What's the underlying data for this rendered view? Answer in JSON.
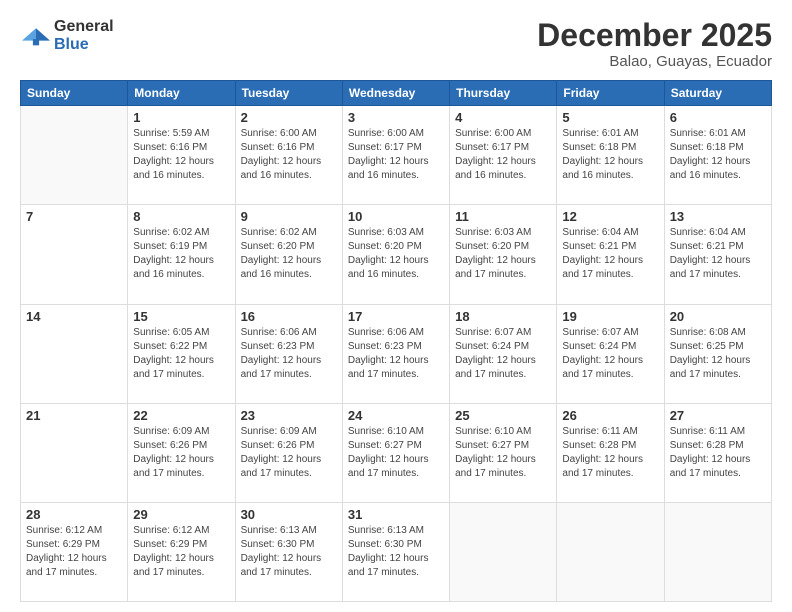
{
  "logo": {
    "general": "General",
    "blue": "Blue"
  },
  "header": {
    "month": "December 2025",
    "location": "Balao, Guayas, Ecuador"
  },
  "weekdays": [
    "Sunday",
    "Monday",
    "Tuesday",
    "Wednesday",
    "Thursday",
    "Friday",
    "Saturday"
  ],
  "weeks": [
    [
      {
        "day": "",
        "info": ""
      },
      {
        "day": "1",
        "info": "Sunrise: 5:59 AM\nSunset: 6:16 PM\nDaylight: 12 hours and 16 minutes."
      },
      {
        "day": "2",
        "info": "Sunrise: 6:00 AM\nSunset: 6:16 PM\nDaylight: 12 hours and 16 minutes."
      },
      {
        "day": "3",
        "info": "Sunrise: 6:00 AM\nSunset: 6:17 PM\nDaylight: 12 hours and 16 minutes."
      },
      {
        "day": "4",
        "info": "Sunrise: 6:00 AM\nSunset: 6:17 PM\nDaylight: 12 hours and 16 minutes."
      },
      {
        "day": "5",
        "info": "Sunrise: 6:01 AM\nSunset: 6:18 PM\nDaylight: 12 hours and 16 minutes."
      },
      {
        "day": "6",
        "info": "Sunrise: 6:01 AM\nSunset: 6:18 PM\nDaylight: 12 hours and 16 minutes."
      }
    ],
    [
      {
        "day": "7",
        "info": ""
      },
      {
        "day": "8",
        "info": "Sunrise: 6:02 AM\nSunset: 6:19 PM\nDaylight: 12 hours and 16 minutes."
      },
      {
        "day": "9",
        "info": "Sunrise: 6:02 AM\nSunset: 6:20 PM\nDaylight: 12 hours and 16 minutes."
      },
      {
        "day": "10",
        "info": "Sunrise: 6:03 AM\nSunset: 6:20 PM\nDaylight: 12 hours and 16 minutes."
      },
      {
        "day": "11",
        "info": "Sunrise: 6:03 AM\nSunset: 6:20 PM\nDaylight: 12 hours and 17 minutes."
      },
      {
        "day": "12",
        "info": "Sunrise: 6:04 AM\nSunset: 6:21 PM\nDaylight: 12 hours and 17 minutes."
      },
      {
        "day": "13",
        "info": "Sunrise: 6:04 AM\nSunset: 6:21 PM\nDaylight: 12 hours and 17 minutes."
      }
    ],
    [
      {
        "day": "14",
        "info": ""
      },
      {
        "day": "15",
        "info": "Sunrise: 6:05 AM\nSunset: 6:22 PM\nDaylight: 12 hours and 17 minutes."
      },
      {
        "day": "16",
        "info": "Sunrise: 6:06 AM\nSunset: 6:23 PM\nDaylight: 12 hours and 17 minutes."
      },
      {
        "day": "17",
        "info": "Sunrise: 6:06 AM\nSunset: 6:23 PM\nDaylight: 12 hours and 17 minutes."
      },
      {
        "day": "18",
        "info": "Sunrise: 6:07 AM\nSunset: 6:24 PM\nDaylight: 12 hours and 17 minutes."
      },
      {
        "day": "19",
        "info": "Sunrise: 6:07 AM\nSunset: 6:24 PM\nDaylight: 12 hours and 17 minutes."
      },
      {
        "day": "20",
        "info": "Sunrise: 6:08 AM\nSunset: 6:25 PM\nDaylight: 12 hours and 17 minutes."
      }
    ],
    [
      {
        "day": "21",
        "info": ""
      },
      {
        "day": "22",
        "info": "Sunrise: 6:09 AM\nSunset: 6:26 PM\nDaylight: 12 hours and 17 minutes."
      },
      {
        "day": "23",
        "info": "Sunrise: 6:09 AM\nSunset: 6:26 PM\nDaylight: 12 hours and 17 minutes."
      },
      {
        "day": "24",
        "info": "Sunrise: 6:10 AM\nSunset: 6:27 PM\nDaylight: 12 hours and 17 minutes."
      },
      {
        "day": "25",
        "info": "Sunrise: 6:10 AM\nSunset: 6:27 PM\nDaylight: 12 hours and 17 minutes."
      },
      {
        "day": "26",
        "info": "Sunrise: 6:11 AM\nSunset: 6:28 PM\nDaylight: 12 hours and 17 minutes."
      },
      {
        "day": "27",
        "info": "Sunrise: 6:11 AM\nSunset: 6:28 PM\nDaylight: 12 hours and 17 minutes."
      }
    ],
    [
      {
        "day": "28",
        "info": "Sunrise: 6:12 AM\nSunset: 6:29 PM\nDaylight: 12 hours and 17 minutes."
      },
      {
        "day": "29",
        "info": "Sunrise: 6:12 AM\nSunset: 6:29 PM\nDaylight: 12 hours and 17 minutes."
      },
      {
        "day": "30",
        "info": "Sunrise: 6:13 AM\nSunset: 6:30 PM\nDaylight: 12 hours and 17 minutes."
      },
      {
        "day": "31",
        "info": "Sunrise: 6:13 AM\nSunset: 6:30 PM\nDaylight: 12 hours and 17 minutes."
      },
      {
        "day": "",
        "info": ""
      },
      {
        "day": "",
        "info": ""
      },
      {
        "day": "",
        "info": ""
      }
    ]
  ]
}
